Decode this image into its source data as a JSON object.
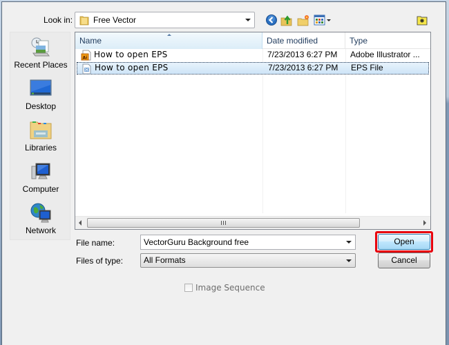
{
  "toolbar": {
    "look_in_label": "Look in:",
    "look_in_value": "Free Vector",
    "icons": [
      "back-icon",
      "up-folder-icon",
      "new-folder-icon",
      "view-menu-icon",
      "special-folder-icon"
    ]
  },
  "places": [
    {
      "label": "Recent Places",
      "icon": "recent-places-icon"
    },
    {
      "label": "Desktop",
      "icon": "desktop-icon"
    },
    {
      "label": "Libraries",
      "icon": "libraries-icon"
    },
    {
      "label": "Computer",
      "icon": "computer-icon"
    },
    {
      "label": "Network",
      "icon": "network-icon"
    }
  ],
  "filelist": {
    "columns": [
      "Name",
      "Date modified",
      "Type"
    ],
    "sorted_column": "Name",
    "rows": [
      {
        "name": "How to open EPS",
        "date": "7/23/2013 6:27 PM",
        "type": "Adobe Illustrator ...",
        "icon": "ai-file-icon",
        "selected": false
      },
      {
        "name": "How to open EPS",
        "date": "7/23/2013 6:27 PM",
        "type": "EPS File",
        "icon": "eps-file-icon",
        "selected": true
      }
    ]
  },
  "form": {
    "file_name_label": "File name:",
    "file_name_value": "VectorGuru Background free",
    "file_type_label": "Files of type:",
    "file_type_value": "All Formats",
    "open_label": "Open",
    "cancel_label": "Cancel",
    "image_sequence_label": "Image Sequence",
    "image_sequence_checked": false,
    "image_sequence_enabled": false
  },
  "colors": {
    "highlight": "#e8000d",
    "selection": "#cde4f7"
  }
}
